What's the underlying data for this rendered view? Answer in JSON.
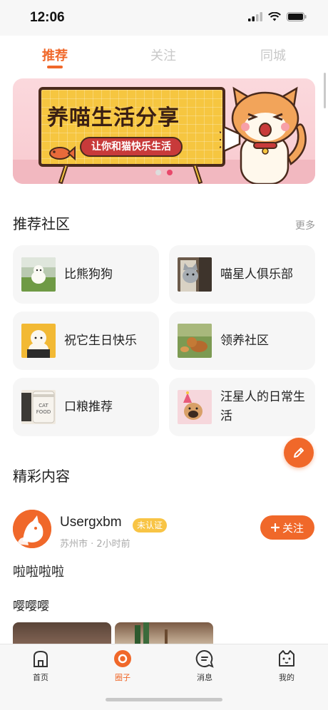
{
  "status_bar": {
    "time": "12:06"
  },
  "tabs": [
    {
      "label": "推荐",
      "active": true
    },
    {
      "label": "关注",
      "active": false
    },
    {
      "label": "同城",
      "active": false
    }
  ],
  "banner": {
    "title": "养喵生活分享",
    "subtitle": "让你和猫快乐生活",
    "page_count": 2,
    "current_page": 2
  },
  "communities": {
    "title": "推荐社区",
    "more_label": "更多",
    "items": [
      {
        "label": "比熊狗狗",
        "icon": "dog-photo"
      },
      {
        "label": "喵星人俱乐部",
        "icon": "cat-photo"
      },
      {
        "label": "祝它生日快乐",
        "icon": "dog-photo"
      },
      {
        "label": "领养社区",
        "icon": "dog-photo"
      },
      {
        "label": "口粮推荐",
        "icon": "cat-food-photo"
      },
      {
        "label": "汪星人的日常生活",
        "icon": "dog-photo"
      }
    ]
  },
  "featured": {
    "title": "精彩内容",
    "post": {
      "username": "Usergxbm",
      "badge": "未认证",
      "meta": "苏州市 · 2小时前",
      "follow_label": "关注",
      "text1": "啦啦啦啦",
      "text2": "嘤嘤嘤"
    }
  },
  "bottom_nav": [
    {
      "label": "首页",
      "icon": "home-icon",
      "active": false
    },
    {
      "label": "圈子",
      "icon": "circle-icon",
      "active": true
    },
    {
      "label": "消息",
      "icon": "message-icon",
      "active": false
    },
    {
      "label": "我的",
      "icon": "cat-face-icon",
      "active": false
    }
  ],
  "colors": {
    "accent": "#f0682a",
    "badge": "#f8c445",
    "banner_bg": "#f8c9cf"
  }
}
